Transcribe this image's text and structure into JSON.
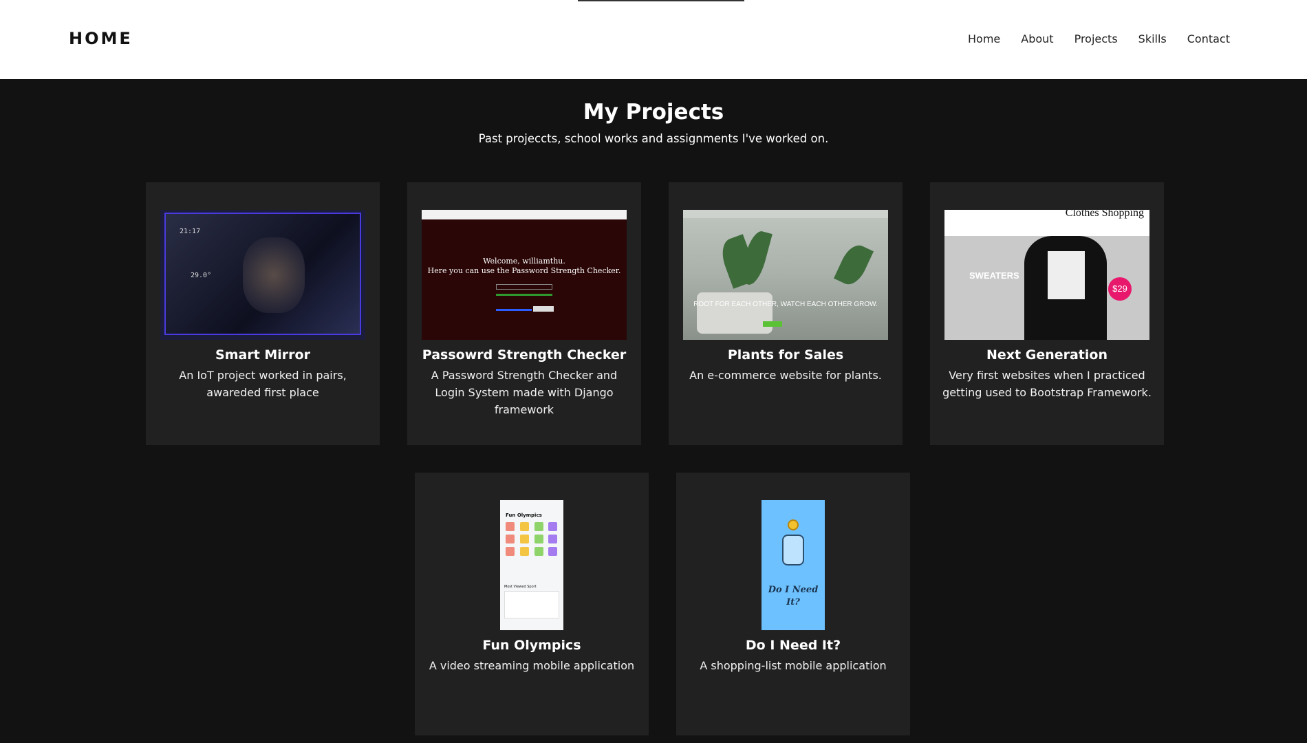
{
  "header": {
    "brand": "HOME",
    "nav": [
      "Home",
      "About",
      "Projects",
      "Skills",
      "Contact"
    ]
  },
  "section": {
    "title": "My Projects",
    "subtitle": "Past projeccts, school works and assignments I've worked on."
  },
  "projects": [
    {
      "title": "Smart Mirror",
      "description": "An IoT project worked in pairs, awareded first place"
    },
    {
      "title": "Passowrd Strength Checker",
      "description": "A Password Strength Checker and Login System made with Django framework"
    },
    {
      "title": "Plants for Sales",
      "description": "An e-commerce website for plants."
    },
    {
      "title": "Next Generation",
      "description": "Very first websites when I practiced getting used to Bootstrap Framework."
    },
    {
      "title": "Fun Olympics",
      "description": "A video streaming mobile application"
    },
    {
      "title": "Do I Need It?",
      "description": "A shopping-list mobile application"
    }
  ],
  "thumbnails": {
    "mirror_time": "21:17",
    "mirror_temp": "29.0°",
    "pwd_welcome": "Welcome, williamthu.",
    "pwd_line": "Here you can use the Password Strength Checker.",
    "plants_slogan": "ROOT FOR EACH OTHER, WATCH EACH OTHER GROW.",
    "nextgen_header": "Clothes Shopping",
    "nextgen_banner": "SWEATERS",
    "nextgen_price": "$29",
    "olympics_title": "Fun Olympics",
    "olympics_most_viewed": "Most Viewed Sport",
    "doineed_title": "Do I Need It?"
  },
  "colors": {
    "page_bg": "#121212",
    "card_bg": "#212121",
    "header_bg": "#ffffff"
  }
}
